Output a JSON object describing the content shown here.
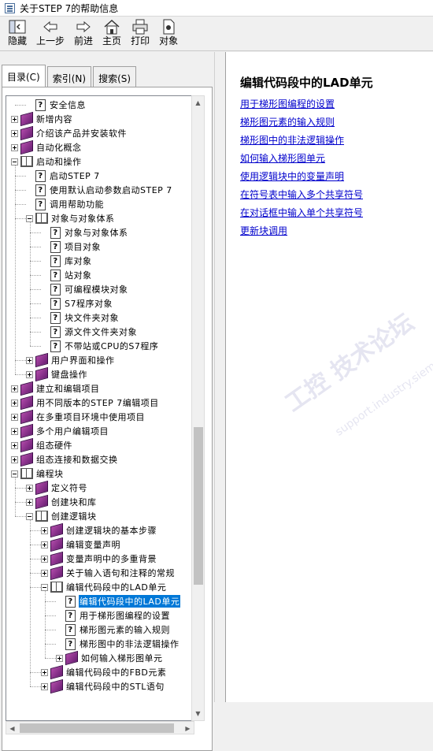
{
  "window": {
    "title": "关于STEP 7的帮助信息"
  },
  "toolbar": {
    "buttons": [
      {
        "label": "隐藏",
        "icon": "hide-icon"
      },
      {
        "label": "上一步",
        "icon": "back-arrow-icon"
      },
      {
        "label": "前进",
        "icon": "forward-arrow-icon"
      },
      {
        "label": "主页",
        "icon": "home-icon"
      },
      {
        "label": "打印",
        "icon": "print-icon"
      },
      {
        "label": "对象",
        "icon": "object-icon"
      }
    ]
  },
  "tabs": [
    {
      "label": "目录(C)",
      "active": true
    },
    {
      "label": "索引(N)",
      "active": false
    },
    {
      "label": "搜索(S)",
      "active": false
    }
  ],
  "tree": [
    {
      "level": 1,
      "type": "doc",
      "label": "安全信息"
    },
    {
      "level": 0,
      "type": "book",
      "state": "closed",
      "label": "新增内容"
    },
    {
      "level": 0,
      "type": "book",
      "state": "closed",
      "label": "介绍该产品并安装软件"
    },
    {
      "level": 0,
      "type": "book",
      "state": "closed",
      "label": "自动化概念"
    },
    {
      "level": 0,
      "type": "book",
      "state": "open",
      "label": "启动和操作"
    },
    {
      "level": 1,
      "type": "doc",
      "label": "启动STEP 7"
    },
    {
      "level": 1,
      "type": "doc",
      "label": "使用默认启动参数启动STEP 7"
    },
    {
      "level": 1,
      "type": "doc",
      "label": "调用帮助功能"
    },
    {
      "level": 1,
      "type": "book",
      "state": "open",
      "label": "对象与对象体系"
    },
    {
      "level": 2,
      "type": "doc",
      "label": "对象与对象体系"
    },
    {
      "level": 2,
      "type": "doc",
      "label": "项目对象"
    },
    {
      "level": 2,
      "type": "doc",
      "label": "库对象"
    },
    {
      "level": 2,
      "type": "doc",
      "label": "站对象"
    },
    {
      "level": 2,
      "type": "doc",
      "label": "可编程模块对象"
    },
    {
      "level": 2,
      "type": "doc",
      "label": "S7程序对象"
    },
    {
      "level": 2,
      "type": "doc",
      "label": "块文件夹对象"
    },
    {
      "level": 2,
      "type": "doc",
      "label": "源文件文件夹对象"
    },
    {
      "level": 2,
      "type": "doc",
      "label": "不带站或CPU的S7程序"
    },
    {
      "level": 1,
      "type": "book",
      "state": "closed",
      "label": "用户界面和操作"
    },
    {
      "level": 1,
      "type": "book",
      "state": "closed",
      "label": "键盘操作"
    },
    {
      "level": 0,
      "type": "book",
      "state": "closed",
      "label": "建立和编辑项目"
    },
    {
      "level": 0,
      "type": "book",
      "state": "closed",
      "label": "用不同版本的STEP 7编辑项目"
    },
    {
      "level": 0,
      "type": "book",
      "state": "closed",
      "label": "在多重项目环境中使用项目"
    },
    {
      "level": 0,
      "type": "book",
      "state": "closed",
      "label": "多个用户编辑项目"
    },
    {
      "level": 0,
      "type": "book",
      "state": "closed",
      "label": "组态硬件"
    },
    {
      "level": 0,
      "type": "book",
      "state": "closed",
      "label": "组态连接和数据交换"
    },
    {
      "level": 0,
      "type": "book",
      "state": "open",
      "label": "编程块"
    },
    {
      "level": 1,
      "type": "book",
      "state": "closed",
      "label": "定义符号"
    },
    {
      "level": 1,
      "type": "book",
      "state": "closed",
      "label": "创建块和库"
    },
    {
      "level": 1,
      "type": "book",
      "state": "open",
      "label": "创建逻辑块"
    },
    {
      "level": 2,
      "type": "book",
      "state": "closed",
      "label": "创建逻辑块的基本步骤"
    },
    {
      "level": 2,
      "type": "book",
      "state": "closed",
      "label": "编辑变量声明"
    },
    {
      "level": 2,
      "type": "book",
      "state": "closed",
      "label": "变量声明中的多重背景"
    },
    {
      "level": 2,
      "type": "book",
      "state": "closed",
      "label": "关于输入语句和注释的常规"
    },
    {
      "level": 2,
      "type": "book",
      "state": "open",
      "label": "编辑代码段中的LAD单元"
    },
    {
      "level": 3,
      "type": "doc",
      "label": "编辑代码段中的LAD单元",
      "selected": true
    },
    {
      "level": 3,
      "type": "doc",
      "label": "用于梯形图编程的设置"
    },
    {
      "level": 3,
      "type": "doc",
      "label": "梯形图元素的输入规则"
    },
    {
      "level": 3,
      "type": "doc",
      "label": "梯形图中的非法逻辑操作"
    },
    {
      "level": 3,
      "type": "book",
      "state": "closed",
      "label": "如何输入梯形图单元"
    },
    {
      "level": 2,
      "type": "book",
      "state": "closed",
      "label": "编辑代码段中的FBD元素"
    },
    {
      "level": 2,
      "type": "book",
      "state": "closed",
      "label": "编辑代码段中的STL语句"
    }
  ],
  "content": {
    "heading": "编辑代码段中的LAD单元",
    "links": [
      "用于梯形图编程的设置",
      "梯形图元素的输入规则",
      "梯形图中的非法逻辑操作",
      "如何输入梯形图单元",
      "使用逻辑块中的变量声明",
      "在符号表中输入多个共享符号",
      "在对话框中输入单个共享符号",
      "更新块调用"
    ]
  },
  "watermark": {
    "text": "工控 技术论坛",
    "subtext": "support.industry.siemens.com/cs"
  }
}
